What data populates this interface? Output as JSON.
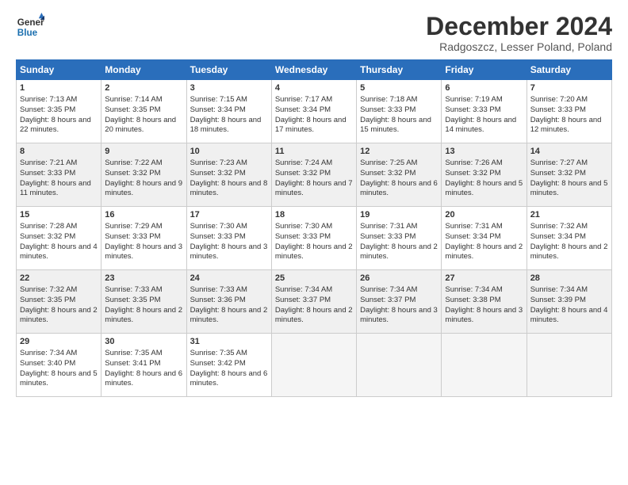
{
  "header": {
    "logo_line1": "General",
    "logo_line2": "Blue",
    "month": "December 2024",
    "location": "Radgoszcz, Lesser Poland, Poland"
  },
  "weekdays": [
    "Sunday",
    "Monday",
    "Tuesday",
    "Wednesday",
    "Thursday",
    "Friday",
    "Saturday"
  ],
  "weeks": [
    [
      {
        "day": "1",
        "sun": "Sunrise: 7:13 AM",
        "set": "Sunset: 3:35 PM",
        "day_text": "Daylight: 8 hours and 22 minutes."
      },
      {
        "day": "2",
        "sun": "Sunrise: 7:14 AM",
        "set": "Sunset: 3:35 PM",
        "day_text": "Daylight: 8 hours and 20 minutes."
      },
      {
        "day": "3",
        "sun": "Sunrise: 7:15 AM",
        "set": "Sunset: 3:34 PM",
        "day_text": "Daylight: 8 hours and 18 minutes."
      },
      {
        "day": "4",
        "sun": "Sunrise: 7:17 AM",
        "set": "Sunset: 3:34 PM",
        "day_text": "Daylight: 8 hours and 17 minutes."
      },
      {
        "day": "5",
        "sun": "Sunrise: 7:18 AM",
        "set": "Sunset: 3:33 PM",
        "day_text": "Daylight: 8 hours and 15 minutes."
      },
      {
        "day": "6",
        "sun": "Sunrise: 7:19 AM",
        "set": "Sunset: 3:33 PM",
        "day_text": "Daylight: 8 hours and 14 minutes."
      },
      {
        "day": "7",
        "sun": "Sunrise: 7:20 AM",
        "set": "Sunset: 3:33 PM",
        "day_text": "Daylight: 8 hours and 12 minutes."
      }
    ],
    [
      {
        "day": "8",
        "sun": "Sunrise: 7:21 AM",
        "set": "Sunset: 3:33 PM",
        "day_text": "Daylight: 8 hours and 11 minutes."
      },
      {
        "day": "9",
        "sun": "Sunrise: 7:22 AM",
        "set": "Sunset: 3:32 PM",
        "day_text": "Daylight: 8 hours and 9 minutes."
      },
      {
        "day": "10",
        "sun": "Sunrise: 7:23 AM",
        "set": "Sunset: 3:32 PM",
        "day_text": "Daylight: 8 hours and 8 minutes."
      },
      {
        "day": "11",
        "sun": "Sunrise: 7:24 AM",
        "set": "Sunset: 3:32 PM",
        "day_text": "Daylight: 8 hours and 7 minutes."
      },
      {
        "day": "12",
        "sun": "Sunrise: 7:25 AM",
        "set": "Sunset: 3:32 PM",
        "day_text": "Daylight: 8 hours and 6 minutes."
      },
      {
        "day": "13",
        "sun": "Sunrise: 7:26 AM",
        "set": "Sunset: 3:32 PM",
        "day_text": "Daylight: 8 hours and 5 minutes."
      },
      {
        "day": "14",
        "sun": "Sunrise: 7:27 AM",
        "set": "Sunset: 3:32 PM",
        "day_text": "Daylight: 8 hours and 5 minutes."
      }
    ],
    [
      {
        "day": "15",
        "sun": "Sunrise: 7:28 AM",
        "set": "Sunset: 3:32 PM",
        "day_text": "Daylight: 8 hours and 4 minutes."
      },
      {
        "day": "16",
        "sun": "Sunrise: 7:29 AM",
        "set": "Sunset: 3:33 PM",
        "day_text": "Daylight: 8 hours and 3 minutes."
      },
      {
        "day": "17",
        "sun": "Sunrise: 7:30 AM",
        "set": "Sunset: 3:33 PM",
        "day_text": "Daylight: 8 hours and 3 minutes."
      },
      {
        "day": "18",
        "sun": "Sunrise: 7:30 AM",
        "set": "Sunset: 3:33 PM",
        "day_text": "Daylight: 8 hours and 2 minutes."
      },
      {
        "day": "19",
        "sun": "Sunrise: 7:31 AM",
        "set": "Sunset: 3:33 PM",
        "day_text": "Daylight: 8 hours and 2 minutes."
      },
      {
        "day": "20",
        "sun": "Sunrise: 7:31 AM",
        "set": "Sunset: 3:34 PM",
        "day_text": "Daylight: 8 hours and 2 minutes."
      },
      {
        "day": "21",
        "sun": "Sunrise: 7:32 AM",
        "set": "Sunset: 3:34 PM",
        "day_text": "Daylight: 8 hours and 2 minutes."
      }
    ],
    [
      {
        "day": "22",
        "sun": "Sunrise: 7:32 AM",
        "set": "Sunset: 3:35 PM",
        "day_text": "Daylight: 8 hours and 2 minutes."
      },
      {
        "day": "23",
        "sun": "Sunrise: 7:33 AM",
        "set": "Sunset: 3:35 PM",
        "day_text": "Daylight: 8 hours and 2 minutes."
      },
      {
        "day": "24",
        "sun": "Sunrise: 7:33 AM",
        "set": "Sunset: 3:36 PM",
        "day_text": "Daylight: 8 hours and 2 minutes."
      },
      {
        "day": "25",
        "sun": "Sunrise: 7:34 AM",
        "set": "Sunset: 3:37 PM",
        "day_text": "Daylight: 8 hours and 2 minutes."
      },
      {
        "day": "26",
        "sun": "Sunrise: 7:34 AM",
        "set": "Sunset: 3:37 PM",
        "day_text": "Daylight: 8 hours and 3 minutes."
      },
      {
        "day": "27",
        "sun": "Sunrise: 7:34 AM",
        "set": "Sunset: 3:38 PM",
        "day_text": "Daylight: 8 hours and 3 minutes."
      },
      {
        "day": "28",
        "sun": "Sunrise: 7:34 AM",
        "set": "Sunset: 3:39 PM",
        "day_text": "Daylight: 8 hours and 4 minutes."
      }
    ],
    [
      {
        "day": "29",
        "sun": "Sunrise: 7:34 AM",
        "set": "Sunset: 3:40 PM",
        "day_text": "Daylight: 8 hours and 5 minutes."
      },
      {
        "day": "30",
        "sun": "Sunrise: 7:35 AM",
        "set": "Sunset: 3:41 PM",
        "day_text": "Daylight: 8 hours and 6 minutes."
      },
      {
        "day": "31",
        "sun": "Sunrise: 7:35 AM",
        "set": "Sunset: 3:42 PM",
        "day_text": "Daylight: 8 hours and 6 minutes."
      },
      null,
      null,
      null,
      null
    ]
  ]
}
